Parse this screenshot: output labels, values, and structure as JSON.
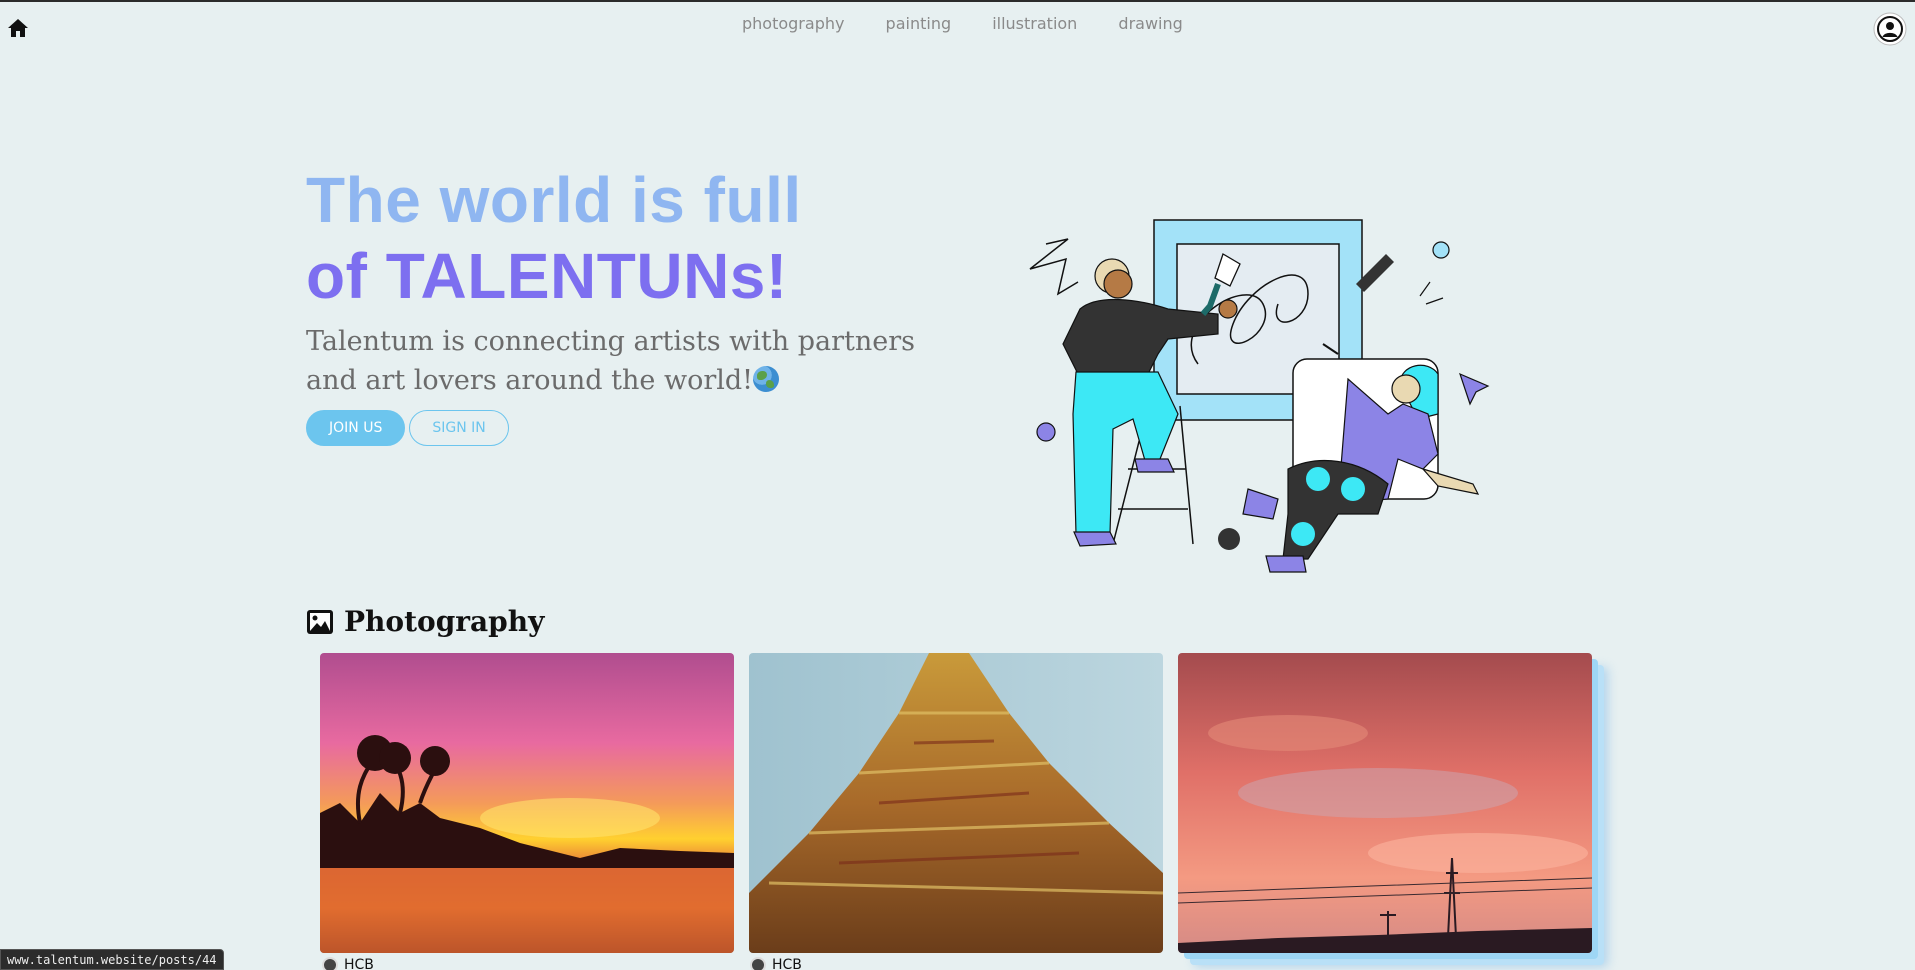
{
  "nav": {
    "items": [
      {
        "label": "photography"
      },
      {
        "label": "painting"
      },
      {
        "label": "illustration"
      },
      {
        "label": "drawing"
      }
    ],
    "home_icon": "home-icon",
    "profile_icon": "user-circle-icon"
  },
  "hero": {
    "title_line1": "The world is full",
    "title_line2": "of TALENTUNs!",
    "subtitle": "Talentum is connecting artists with partners and art lovers around the world!",
    "join_label": "JOIN US",
    "signin_label": "SIGN IN",
    "illustration": "artists-painting-illustration"
  },
  "section": {
    "icon": "image-icon",
    "title": "Photography",
    "cards": [
      {
        "image": "sunset-palm-trees-lake",
        "author": "HCB"
      },
      {
        "image": "temple-pagoda-closeup",
        "author": "HCB"
      },
      {
        "image": "pink-cloudy-sky-power-tower",
        "author": ""
      }
    ]
  },
  "status_bar": {
    "url": "www.talentum.website/posts/44"
  },
  "colors": {
    "background": "#e7f0f1",
    "title_light": "#8fb6f1",
    "title_dark": "#7d6ff0",
    "accent": "#6cc5ee"
  }
}
